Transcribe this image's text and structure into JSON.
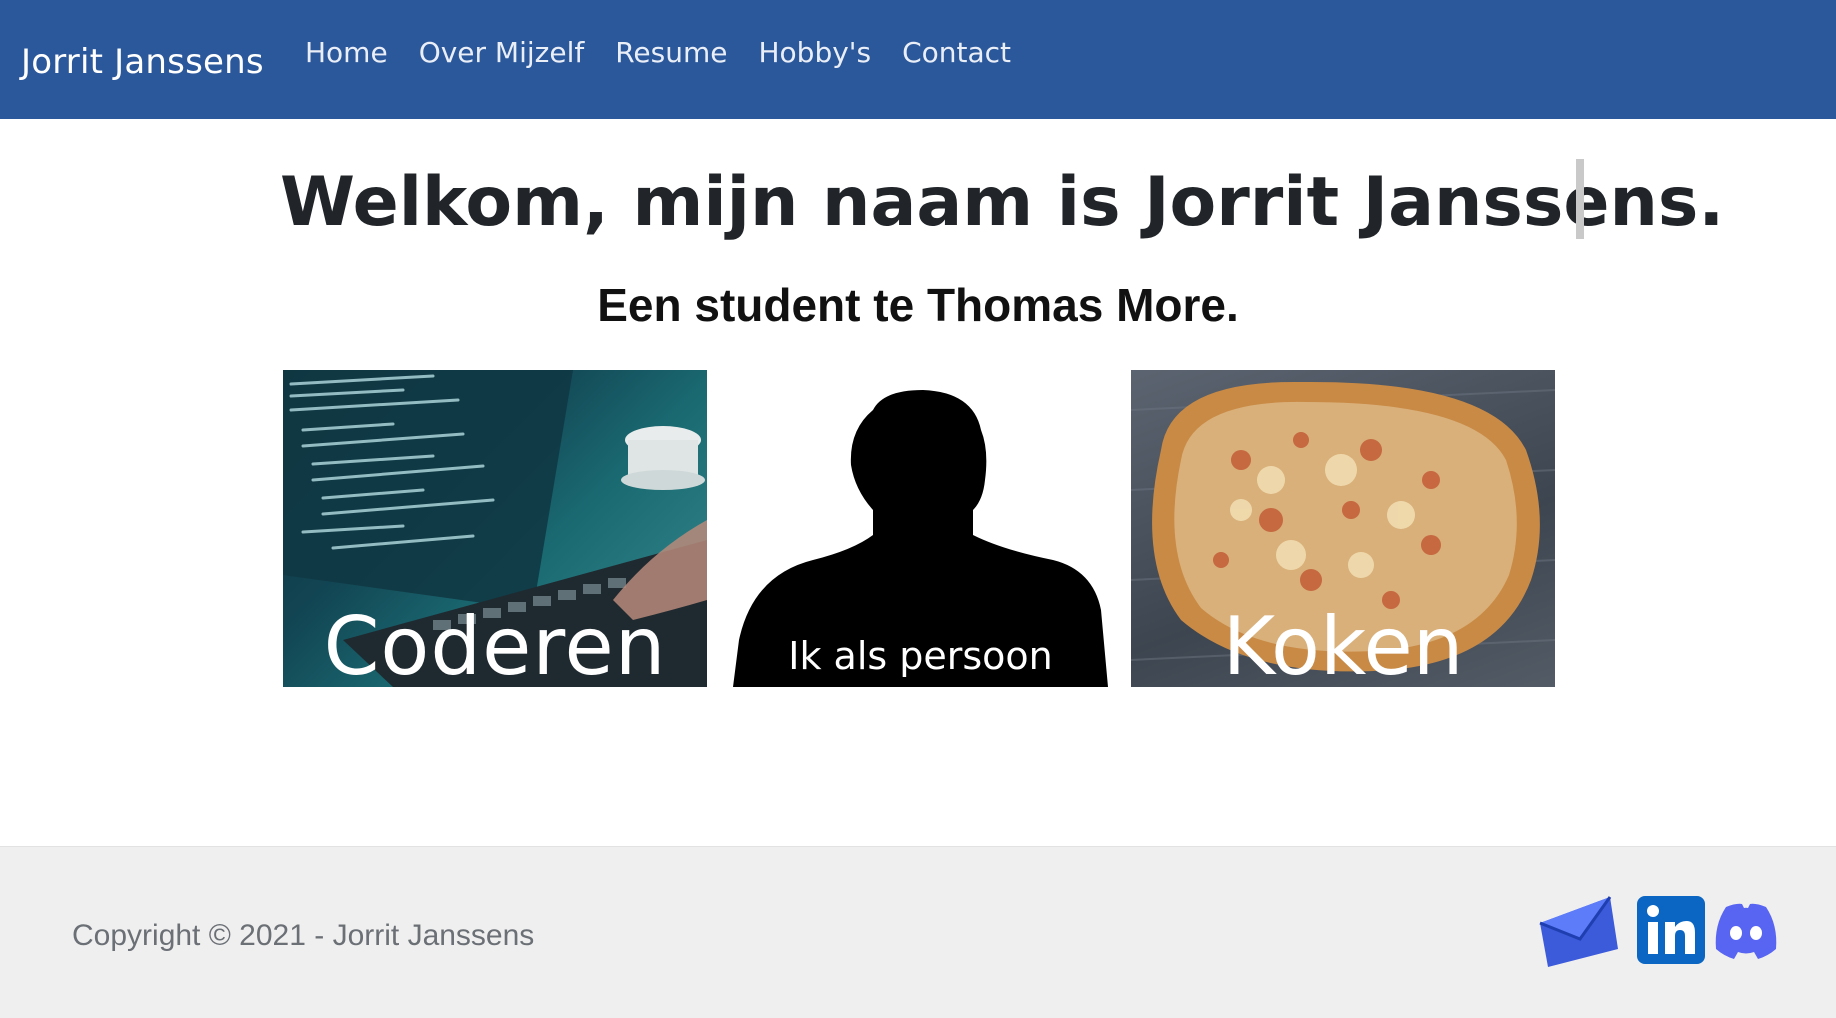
{
  "navbar": {
    "brand": "Jorrit Janssens",
    "links": [
      "Home",
      "Over Mijzelf",
      "Resume",
      "Hobby's",
      "Contact"
    ]
  },
  "hero": {
    "title": "Welkom, mijn naam is Jorrit Janssens.",
    "subtitle": "Een student te Thomas More."
  },
  "cards": [
    {
      "label": "Coderen",
      "image": "laptop-with-code"
    },
    {
      "label": "Ik als persoon",
      "image": "person-silhouette"
    },
    {
      "label": "Koken",
      "image": "homemade-pizza"
    }
  ],
  "footer": {
    "copyright": "Copyright © 2021 - Jorrit Janssens",
    "social": [
      "mail-icon",
      "linkedin-icon",
      "discord-icon"
    ]
  },
  "colors": {
    "navbar": "#2b579b",
    "footer": "#f0efef",
    "linkedin": "#0a66c2",
    "discord": "#5865f2",
    "mail": "#3b5bdb"
  }
}
